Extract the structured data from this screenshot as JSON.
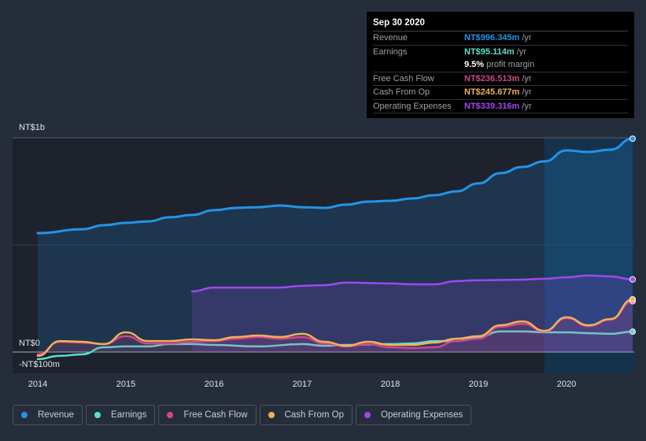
{
  "tooltip": {
    "date": "Sep 30 2020",
    "rows": [
      {
        "label": "Revenue",
        "value": "NT$996.345m",
        "unit": "/yr",
        "color": "#2394e8"
      },
      {
        "label": "Earnings",
        "value": "NT$95.114m",
        "unit": "/yr",
        "color": "#5ce0d2"
      },
      {
        "label": "",
        "value": "9.5%",
        "unit": "profit margin",
        "color": "#ffffff"
      },
      {
        "label": "Free Cash Flow",
        "value": "NT$236.513m",
        "unit": "/yr",
        "color": "#d2468c"
      },
      {
        "label": "Cash From Op",
        "value": "NT$245.677m",
        "unit": "/yr",
        "color": "#f0b254"
      },
      {
        "label": "Operating Expenses",
        "value": "NT$339.316m",
        "unit": "/yr",
        "color": "#a146f0"
      }
    ]
  },
  "chart_data": {
    "type": "line",
    "ylim": [
      -100,
      1000
    ],
    "xlim": [
      2013.7,
      2020.75
    ],
    "y_tick_labels": [
      {
        "value": 1000,
        "label": "NT$1b"
      },
      {
        "value": 0,
        "label": "NT$0"
      },
      {
        "value": -100,
        "label": "-NT$100m"
      }
    ],
    "x_tick_labels": [
      "2014",
      "2015",
      "2016",
      "2017",
      "2018",
      "2019",
      "2020"
    ],
    "highlight_from": 2019.75,
    "series": [
      {
        "name": "Revenue",
        "color": "#2394e8",
        "area": true,
        "x": [
          2014,
          2014.5,
          2014.75,
          2015,
          2015.25,
          2015.5,
          2015.75,
          2016,
          2016.25,
          2016.5,
          2016.75,
          2017,
          2017.25,
          2017.5,
          2017.75,
          2018,
          2018.25,
          2018.5,
          2018.75,
          2019,
          2019.25,
          2019.5,
          2019.75,
          2020,
          2020.25,
          2020.5,
          2020.75
        ],
        "y": [
          555,
          573,
          592,
          603,
          610,
          629,
          640,
          662,
          673,
          676,
          684,
          676,
          673,
          688,
          702,
          706,
          717,
          732,
          750,
          787,
          835,
          864,
          890,
          941,
          934,
          945,
          996
        ]
      },
      {
        "name": "Operating Expenses",
        "color": "#a146f0",
        "area": true,
        "x": [
          2015.75,
          2016,
          2016.5,
          2016.75,
          2017,
          2017.25,
          2017.5,
          2018,
          2018.25,
          2018.5,
          2018.75,
          2019,
          2019.5,
          2019.75,
          2020,
          2020.25,
          2020.5,
          2020.75
        ],
        "y": [
          283,
          301,
          301,
          301,
          309,
          312,
          324,
          320,
          316,
          316,
          331,
          335,
          338,
          342,
          349,
          357,
          353,
          339
        ]
      },
      {
        "name": "Earnings",
        "color": "#5ce0d2",
        "area": false,
        "x": [
          2014,
          2014.25,
          2014.5,
          2014.75,
          2015,
          2015.25,
          2015.5,
          2015.75,
          2016,
          2016.5,
          2017,
          2017.25,
          2017.5,
          2018,
          2018.25,
          2018.5,
          2018.75,
          2019,
          2019.25,
          2019.5,
          2019.75,
          2020,
          2020.25,
          2020.5,
          2020.75
        ],
        "y": [
          -33,
          -18,
          -11,
          22,
          26,
          26,
          37,
          37,
          33,
          26,
          37,
          29,
          33,
          37,
          40,
          51,
          51,
          70,
          96,
          96,
          92,
          92,
          88,
          85,
          95
        ]
      },
      {
        "name": "Free Cash Flow",
        "color": "#d2468c",
        "area": true,
        "x": [
          2014,
          2014.25,
          2014.5,
          2014.75,
          2015,
          2015.25,
          2015.5,
          2015.75,
          2016,
          2016.25,
          2016.5,
          2016.75,
          2017,
          2017.25,
          2017.5,
          2017.75,
          2018,
          2018.25,
          2018.5,
          2018.75,
          2019,
          2019.25,
          2019.5,
          2019.75,
          2020,
          2020.25,
          2020.5,
          2020.75
        ],
        "y": [
          -11,
          48,
          44,
          37,
          74,
          40,
          40,
          48,
          51,
          62,
          70,
          62,
          70,
          40,
          26,
          37,
          22,
          18,
          22,
          51,
          62,
          118,
          132,
          96,
          158,
          121,
          151,
          237
        ]
      },
      {
        "name": "Cash From Op",
        "color": "#f0b254",
        "area": false,
        "x": [
          2014,
          2014.25,
          2014.5,
          2014.75,
          2015,
          2015.25,
          2015.5,
          2015.75,
          2016,
          2016.25,
          2016.5,
          2016.75,
          2017,
          2017.25,
          2017.5,
          2017.75,
          2018,
          2018.25,
          2018.5,
          2018.75,
          2019,
          2019.25,
          2019.5,
          2019.75,
          2020,
          2020.25,
          2020.5,
          2020.75
        ],
        "y": [
          -18,
          51,
          48,
          37,
          92,
          51,
          51,
          59,
          55,
          70,
          77,
          70,
          85,
          48,
          29,
          48,
          33,
          33,
          44,
          62,
          74,
          125,
          143,
          99,
          162,
          125,
          154,
          246
        ]
      }
    ]
  },
  "legend": [
    {
      "label": "Revenue",
      "color": "#2394e8"
    },
    {
      "label": "Earnings",
      "color": "#5ce0d2"
    },
    {
      "label": "Free Cash Flow",
      "color": "#d2468c"
    },
    {
      "label": "Cash From Op",
      "color": "#f0b254"
    },
    {
      "label": "Operating Expenses",
      "color": "#a146f0"
    }
  ]
}
